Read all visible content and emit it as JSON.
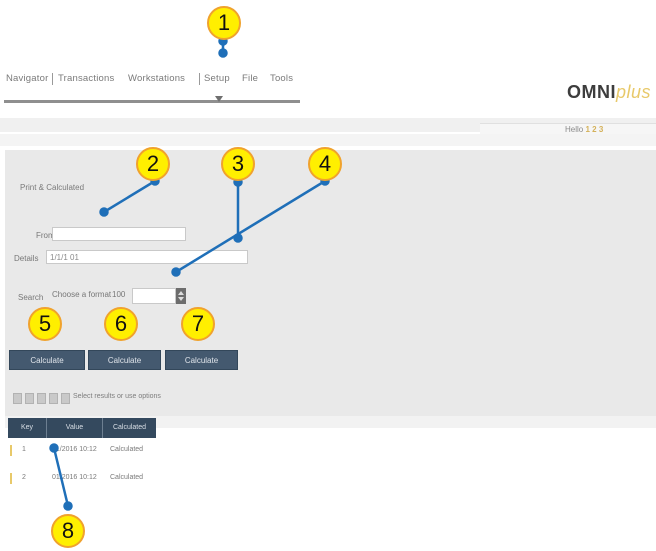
{
  "app": {
    "tabs": [
      "Navigator",
      "Transactions",
      "Workstations",
      "Setup",
      "File",
      "Tools"
    ],
    "logo_bold": "OMNI",
    "logo_light": "plus",
    "meta_text": "Hello",
    "meta_highlight": "1 2 3"
  },
  "panel": {
    "title": "Print & Calculated",
    "fields": {
      "from_label": "From",
      "from_value": "",
      "details_label": "Details",
      "details_value": "1/1/1 01",
      "search_label": "Search",
      "search_text": "Choose a format",
      "search_count": "100"
    },
    "buttons": [
      "Calculate",
      "Calculate",
      "Calculate"
    ]
  },
  "toolbar": {
    "text": "Select results or use options"
  },
  "table": {
    "columns": [
      "Key",
      "Value",
      "Calculated"
    ],
    "rows": [
      [
        "1",
        "01/2016 10:12",
        "Calculated"
      ],
      [
        "2",
        "01/2016 10:12",
        "Calculated"
      ]
    ]
  },
  "callouts": [
    "1",
    "2",
    "3",
    "4",
    "5",
    "6",
    "7",
    "8"
  ],
  "colors": {
    "callout_fill": "#ffef00",
    "callout_border": "#f0a22d",
    "leader_line": "#1f6fb8",
    "button_bg": "#44596f",
    "table_header_bg": "#34495e"
  }
}
